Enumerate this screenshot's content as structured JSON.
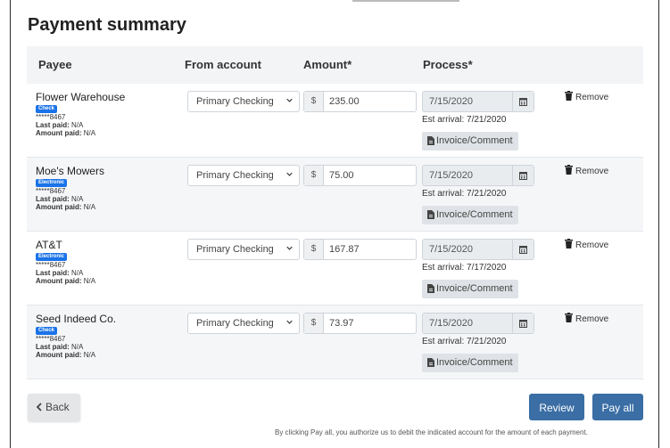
{
  "page": {
    "title": "Payment summary"
  },
  "table": {
    "headers": {
      "payee": "Payee",
      "from": "From account",
      "amount": "Amount*",
      "process": "Process*"
    },
    "rows": [
      {
        "payee": "Flower Warehouse",
        "badge": "Check",
        "account": "*****8467",
        "last_paid_label": "Last paid:",
        "last_paid": "N/A",
        "amount_paid_label": "Amount paid:",
        "amount_paid": "N/A",
        "from_account": "Primary Checking",
        "currency": "$",
        "amount": "235.00",
        "process_date": "7/15/2020",
        "est_arrival": "Est arrival: 7/21/2020",
        "invoice": "Invoice/Comment",
        "remove": "Remove"
      },
      {
        "payee": "Moe's Mowers",
        "badge": "Electronic",
        "account": "*****8467",
        "last_paid_label": "Last paid:",
        "last_paid": "N/A",
        "amount_paid_label": "Amount paid:",
        "amount_paid": "N/A",
        "from_account": "Primary Checking",
        "currency": "$",
        "amount": "75.00",
        "process_date": "7/15/2020",
        "est_arrival": "Est arrival: 7/21/2020",
        "invoice": "Invoice/Comment",
        "remove": "Remove"
      },
      {
        "payee": "AT&T",
        "badge": "Electronic",
        "account": "*****8467",
        "last_paid_label": "Last paid:",
        "last_paid": "N/A",
        "amount_paid_label": "Amount paid:",
        "amount_paid": "N/A",
        "from_account": "Primary Checking",
        "currency": "$",
        "amount": "167.87",
        "process_date": "7/15/2020",
        "est_arrival": "Est arrival: 7/17/2020",
        "invoice": "Invoice/Comment",
        "remove": "Remove"
      },
      {
        "payee": "Seed Indeed Co.",
        "badge": "Check",
        "account": "*****8467",
        "last_paid_label": "Last paid:",
        "last_paid": "N/A",
        "amount_paid_label": "Amount paid:",
        "amount_paid": "N/A",
        "from_account": "Primary Checking",
        "currency": "$",
        "amount": "73.97",
        "process_date": "7/15/2020",
        "est_arrival": "Est arrival: 7/21/2020",
        "invoice": "Invoice/Comment",
        "remove": "Remove"
      }
    ]
  },
  "actions": {
    "back": "Back",
    "review": "Review",
    "pay_all": "Pay all"
  },
  "disclaimer": "By clicking Pay all, you authorize us to debit the indicated account for the amount of each payment.",
  "colors": {
    "primary": "#3a6ea5",
    "badge": "#1a73e8"
  },
  "icons": {
    "calendar": "calendar-icon",
    "trash": "trash-icon",
    "invoice": "document-icon",
    "back": "chevron-left-icon",
    "select": "chevron-down-icon"
  }
}
